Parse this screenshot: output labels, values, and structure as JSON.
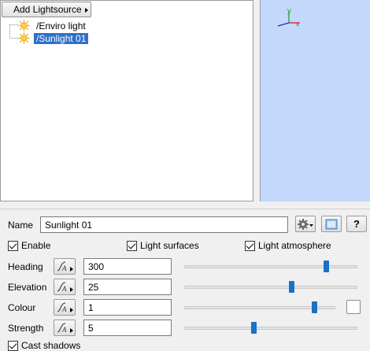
{
  "toolbar": {
    "add_lightsource_label": "Add Lightsource"
  },
  "tree": {
    "items": [
      {
        "label": "/Enviro light",
        "selected": false
      },
      {
        "label": "/Sunlight 01",
        "selected": true
      }
    ]
  },
  "viewport": {
    "axis_y_label": "y",
    "axis_x_label": "x",
    "background": "#c3d8fb"
  },
  "props": {
    "name_label": "Name",
    "name_value": "Sunlight 01",
    "enable_label": "Enable",
    "enable_checked": true,
    "light_surfaces_label": "Light surfaces",
    "light_surfaces_checked": true,
    "light_atmosphere_label": "Light atmosphere",
    "light_atmosphere_checked": true,
    "help_label": "?",
    "rows": [
      {
        "label": "Heading",
        "value": "300",
        "slider": 0.82
      },
      {
        "label": "Elevation",
        "value": "25",
        "slider": 0.62
      },
      {
        "label": "Colour",
        "value": "1",
        "slider": 0.86
      },
      {
        "label": "Strength",
        "value": "5",
        "slider": 0.4
      }
    ],
    "cast_shadows_label": "Cast shadows",
    "cast_shadows_checked": true
  },
  "colors": {
    "selection": "#2f6fc8",
    "slider_thumb": "#1a72c8"
  }
}
